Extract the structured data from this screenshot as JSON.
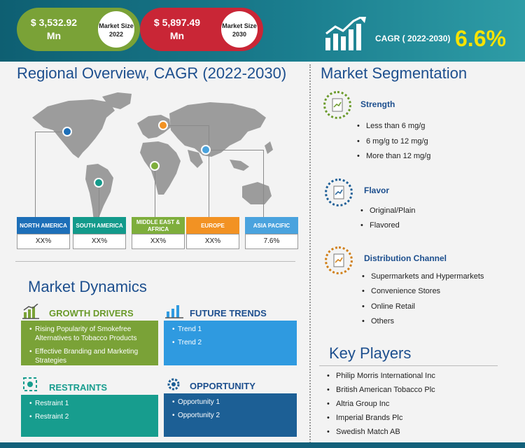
{
  "header": {
    "market_2022_value": "$ 3,532.92 Mn",
    "market_2022_label": "Market Size 2022",
    "market_2030_value": "$ 5,897.49 Mn",
    "market_2030_label": "Market Size 2030",
    "cagr_label": "CAGR ( 2022-2030)",
    "cagr_value": "6.6%"
  },
  "regional": {
    "title": "Regional Overview,  CAGR (2022-2030)",
    "regions": [
      {
        "name": "NORTH AMERICA",
        "value": "XX%",
        "color": "#1d6fb8"
      },
      {
        "name": "SOUTH AMERICA",
        "value": "XX%",
        "color": "#139a8b"
      },
      {
        "name": "MIDDLE EAST & AFRICA",
        "value": "XX%",
        "color": "#7eae3c"
      },
      {
        "name": "EUROPE",
        "value": "XX%",
        "color": "#f29223"
      },
      {
        "name": "ASIA PACIFIC",
        "value": "7.6%",
        "color": "#4aa3de"
      }
    ]
  },
  "dynamics": {
    "title": "Market Dynamics",
    "growth_drivers": {
      "heading": "GROWTH DRIVERS",
      "color": "#7aa237",
      "items": [
        "Rising Popularity of Smokefree Alternatives to Tobacco Products",
        "Effective Branding and Marketing Strategies"
      ]
    },
    "future_trends": {
      "heading": "FUTURE TRENDS",
      "color": "#2f9ae0",
      "items": [
        "Trend 1",
        "Trend 2"
      ]
    },
    "restraints": {
      "heading": "RESTRAINTS",
      "color": "#179d8e",
      "items": [
        "Restraint 1",
        "Restraint 2"
      ]
    },
    "opportunity": {
      "heading": "OPPORTUNITY",
      "color": "#1c5f95",
      "items": [
        "Opportunity 1",
        "Opportunity 2"
      ]
    }
  },
  "segmentation": {
    "title": "Market Segmentation",
    "groups": [
      {
        "title": "Strength",
        "color": "#6a9a2a",
        "items": [
          "Less than 6 mg/g",
          "6 mg/g to 12 mg/g",
          "More than 12 mg/g"
        ]
      },
      {
        "title": "Flavor",
        "color": "#1e5f97",
        "items": [
          "Original/Plain",
          "Flavored"
        ]
      },
      {
        "title": "Distribution Channel",
        "color": "#d07e14",
        "items": [
          "Supermarkets and Hypermarkets",
          "Convenience Stores",
          "Online Retail",
          "Others"
        ]
      }
    ]
  },
  "key_players": {
    "title": "Key Players",
    "items": [
      "Philip Morris International Inc",
      "British American Tobacco Plc",
      "Altria Group Inc",
      "Imperial Brands Plc",
      "Swedish Match AB"
    ]
  }
}
